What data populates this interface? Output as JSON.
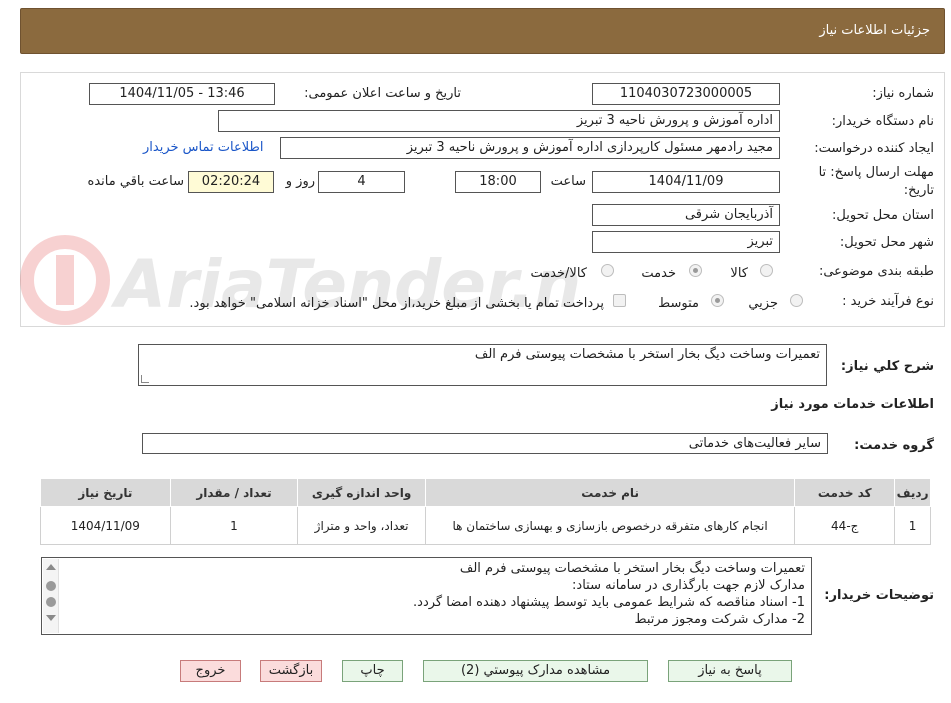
{
  "header": {
    "title": "جزئیات اطلاعات نیاز"
  },
  "form": {
    "need_number": {
      "label": "شماره نیاز:",
      "value": "1104030723000005"
    },
    "announce_datetime": {
      "label": "تاریخ و ساعت اعلان عمومی:",
      "value": "1404/11/05 - 13:46"
    },
    "buyer_org": {
      "label": "نام دستگاه خريدار:",
      "value": "اداره آموزش و پرورش ناحیه 3 تبریز"
    },
    "requester": {
      "label": "ايجاد كننده درخواست:",
      "value": "مجید رادمهر مسئول کارپردازی اداره آموزش و پرورش ناحیه 3 تبریز"
    },
    "contact_link": "اطلاعات تماس خریدار",
    "deadline": {
      "label_line1": "مهلت ارسال پاسخ: تا",
      "label_line2": "تاریخ:",
      "date": "1404/11/09",
      "time_label": "ساعت",
      "time": "18:00",
      "days": "4",
      "days_label": "روز و",
      "remaining": "02:20:24",
      "remaining_label": "ساعت باقي مانده"
    },
    "province": {
      "label": "استان محل تحویل:",
      "value": "آذربایجان شرقی"
    },
    "city": {
      "label": "شهر محل تحویل:",
      "value": "تبریز"
    },
    "category": {
      "label": "طبقه بندی موضوعی:",
      "options": [
        "کالا",
        "خدمت",
        "کالا/خدمت"
      ],
      "selected": "خدمت"
    },
    "process": {
      "label": "نوع فرآیند خرید :",
      "options": [
        "جزیي",
        "متوسط"
      ],
      "selected": "متوسط",
      "payment_note": "پرداخت تمام یا بخشی از مبلغ خرید،از محل \"اسناد خزانه اسلامی\" خواهد بود."
    }
  },
  "general_description": {
    "label": "شرح کلي نياز:",
    "value": "تعمیرات وساخت دیگ بخار استخر با مشخصات پیوستی فرم الف"
  },
  "services_section": {
    "title": "اطلاعات خدمات مورد نياز",
    "group_label": "گروه خدمت:",
    "group_value": "سایر فعالیت‌های خدماتی"
  },
  "table": {
    "headers": [
      "رديف",
      "کد خدمت",
      "نام خدمت",
      "واحد اندازه گيری",
      "تعداد / مقدار",
      "تاريخ نياز"
    ],
    "rows": [
      [
        "1",
        "ج-44",
        "انجام کارهای متفرقه درخصوص بازسازی و بهسازی ساختمان ها",
        "تعداد، واحد و متراژ",
        "1",
        "1404/11/09"
      ]
    ]
  },
  "buyer_notes": {
    "label": "توضیحات خریدار:",
    "lines": [
      "تعمیرات وساخت دیگ بخار استخر با مشخصات پیوستی فرم الف",
      "مدارک لازم جهت بارگذاری در سامانه ستاد:",
      "1-     اسناد مناقصه که شرایط عمومی باید توسط پیشنهاد دهنده امضا گردد.",
      "2-     مدارک شرکت ومجوز مرتبط"
    ]
  },
  "buttons": {
    "reply": "پاسخ به نیاز",
    "attachments": "مشاهده مدارک پیوستي (2)",
    "print": "چاپ",
    "back": "بازگشت",
    "exit": "خروج"
  },
  "watermark": {
    "text": "AriaTender.neT"
  }
}
